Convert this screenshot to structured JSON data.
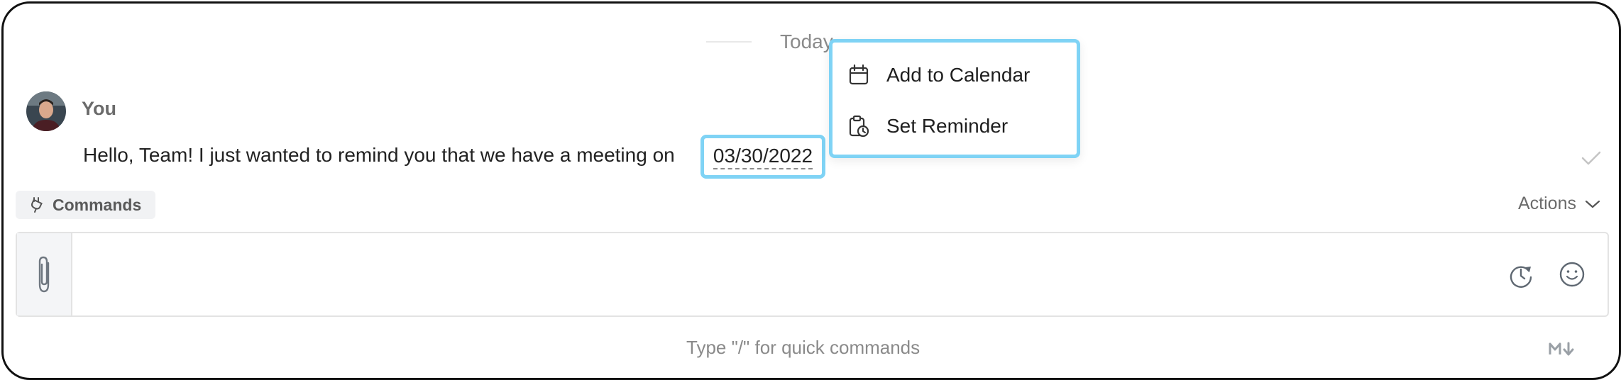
{
  "timeline": {
    "day_label": "Today"
  },
  "message": {
    "author": "You",
    "text": "Hello, Team! I just wanted to remind you that we have a meeting on",
    "date": "03/30/2022",
    "status_icon": "checkmark-icon"
  },
  "date_menu": {
    "items": [
      {
        "label": "Add to Calendar",
        "icon": "calendar-icon"
      },
      {
        "label": "Set Reminder",
        "icon": "clipboard-clock-icon"
      }
    ]
  },
  "toolbar": {
    "commands_label": "Commands",
    "actions_label": "Actions"
  },
  "composer": {
    "value": "",
    "placeholder": ""
  },
  "footer": {
    "hint": "Type \"/\" for quick commands"
  },
  "colors": {
    "highlight": "#7fd3f5",
    "muted_text": "#8a8a8a",
    "primary_text": "#222222"
  }
}
